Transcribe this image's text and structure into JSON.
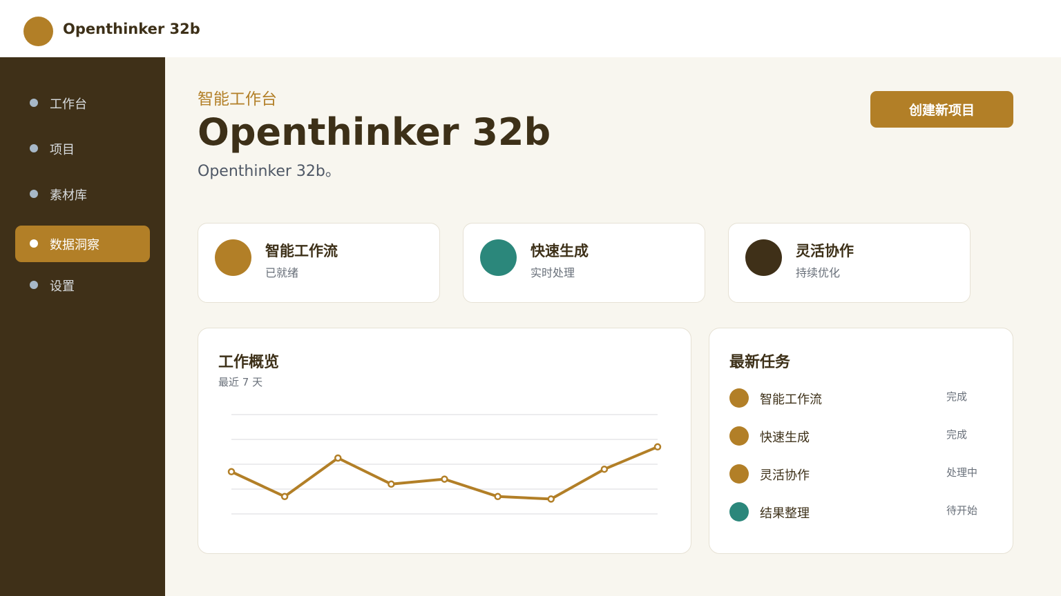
{
  "app": {
    "name": "Openthinker 32b"
  },
  "sidebar": {
    "items": [
      {
        "label": "工作台",
        "active": false
      },
      {
        "label": "项目",
        "active": false
      },
      {
        "label": "素材库",
        "active": false
      },
      {
        "label": "数据洞察",
        "active": true
      },
      {
        "label": "设置",
        "active": false
      }
    ]
  },
  "hero": {
    "kicker": "智能工作台",
    "title": "Openthinker 32b",
    "subtitle": "Openthinker 32b。",
    "create_button": "创建新项目"
  },
  "features": [
    {
      "title": "智能工作流",
      "sub": "已就绪",
      "color": "#b27f27"
    },
    {
      "title": "快速生成",
      "sub": "实时处理",
      "color": "#2b877b"
    },
    {
      "title": "灵活协作",
      "sub": "持续优化",
      "color": "#3f3018"
    }
  ],
  "overview": {
    "title": "工作概览",
    "sub": "最近 7 天"
  },
  "chart_data": {
    "type": "line",
    "title": "",
    "xlabel": "",
    "ylabel": "",
    "x": [
      1,
      2,
      3,
      4,
      5,
      6,
      7,
      8,
      9
    ],
    "ylim": [
      0,
      8
    ],
    "grid": true,
    "series": [
      {
        "values": [
          3.4,
          1.4,
          4.5,
          2.4,
          2.8,
          1.4,
          1.2,
          3.6,
          5.4
        ],
        "color": "#b27f27"
      }
    ]
  },
  "tasks": {
    "title": "最新任务",
    "items": [
      {
        "name": "智能工作流",
        "status": "完成",
        "color": "#b27f27"
      },
      {
        "name": "快速生成",
        "status": "完成",
        "color": "#b27f27"
      },
      {
        "name": "灵活协作",
        "status": "处理中",
        "color": "#b27f27"
      },
      {
        "name": "结果整理",
        "status": "待开始",
        "color": "#2b877b"
      }
    ]
  }
}
